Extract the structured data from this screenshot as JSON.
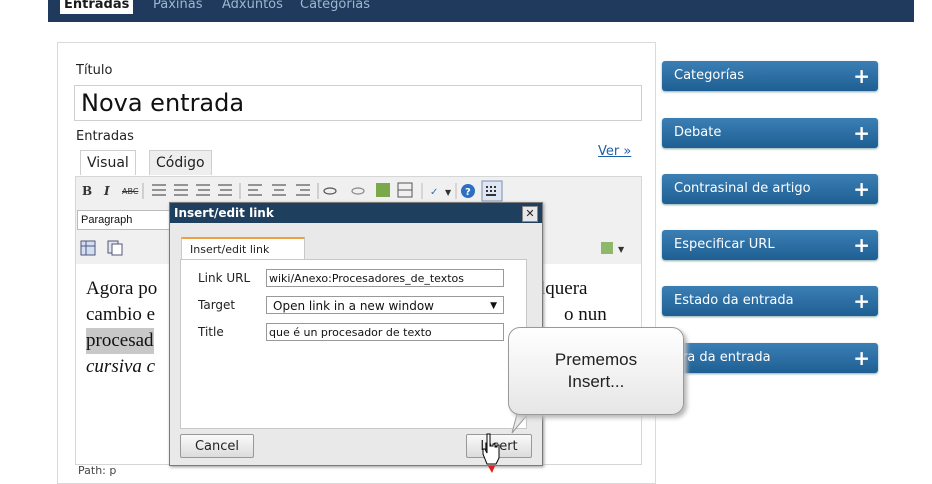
{
  "top_tabs": [
    "Entradas",
    "Páxinas",
    "Adxuntos",
    "Categorías"
  ],
  "title_label": "Título",
  "title_value": "Nova entrada",
  "content_label": "Entradas",
  "editor_tabs": [
    "Visual",
    "Código"
  ],
  "view_link": "Ver »",
  "format_select": "Paragraph",
  "toolbar": {
    "bold": "B",
    "italic": "I",
    "strike": "ABC"
  },
  "editor_text": {
    "line1_left": "Agora po",
    "line2_left": "cambio e",
    "line3_left": "procesad",
    "line4_left": "cursiva c",
    "line1_right": "lquera",
    "line2_right": "o nun"
  },
  "path_text": "Path: p",
  "sidebar": [
    {
      "label": "Categorías"
    },
    {
      "label": "Debate"
    },
    {
      "label": "Contrasinal de artigo"
    },
    {
      "label": "Especificar URL"
    },
    {
      "label": "Estado da entrada"
    },
    {
      "label": "ora da entrada"
    }
  ],
  "sidebar_plus": "+",
  "modal": {
    "title": "Insert/edit link",
    "close": "✕",
    "tab": "Insert/edit link",
    "url_label": "Link URL",
    "url_value": "wiki/Anexo:Procesadores_de_textos",
    "target_label": "Target",
    "target_value": "Open link in a new window",
    "title_label": "Title",
    "title_value": "que é un procesador de texto",
    "cancel": "Cancel",
    "insert": "Insert"
  },
  "callout": {
    "line1": "Prememos",
    "line2": "Insert..."
  }
}
